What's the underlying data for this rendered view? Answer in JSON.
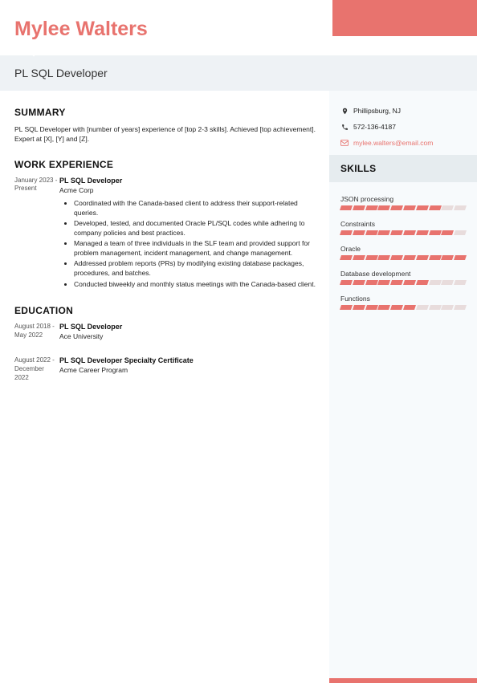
{
  "name": "Mylee Walters",
  "title": "PL SQL Developer",
  "summary_heading": "SUMMARY",
  "summary_text": "PL SQL Developer with [number of years] experience of [top 2-3 skills]. Achieved [top achievement]. Expert at [X], [Y] and [Z].",
  "work_heading": "WORK EXPERIENCE",
  "work": [
    {
      "date": "January 2023 - Present",
      "title": "PL SQL Developer",
      "company": "Acme Corp",
      "bullets": [
        "Coordinated with the Canada-based client to address their support-related queries.",
        "Developed, tested, and documented Oracle PL/SQL codes while adhering to company policies and best practices.",
        "Managed a team of three individuals in the SLF team and provided support for problem management, incident management, and change management.",
        "Addressed problem reports (PRs) by modifying existing database packages, procedures, and batches.",
        "Conducted biweekly and monthly status meetings with the Canada-based client."
      ]
    }
  ],
  "edu_heading": "EDUCATION",
  "education": [
    {
      "date": "August 2018 - May 2022",
      "title": "PL SQL Developer",
      "school": "Ace University"
    },
    {
      "date": "August 2022 - December 2022",
      "title": "PL SQL Developer Specialty Certificate",
      "school": "Acme Career Program"
    }
  ],
  "contact": {
    "location": "Phillipsburg, NJ",
    "phone": "572-136-4187",
    "email": "mylee.walters@email.com"
  },
  "skills_heading": "SKILLS",
  "skills": [
    {
      "name": "JSON processing",
      "level": 8,
      "max": 10
    },
    {
      "name": "Constraints",
      "level": 9,
      "max": 10
    },
    {
      "name": "Oracle",
      "level": 10,
      "max": 10
    },
    {
      "name": "Database development",
      "level": 7,
      "max": 10
    },
    {
      "name": "Functions",
      "level": 6,
      "max": 10
    }
  ]
}
